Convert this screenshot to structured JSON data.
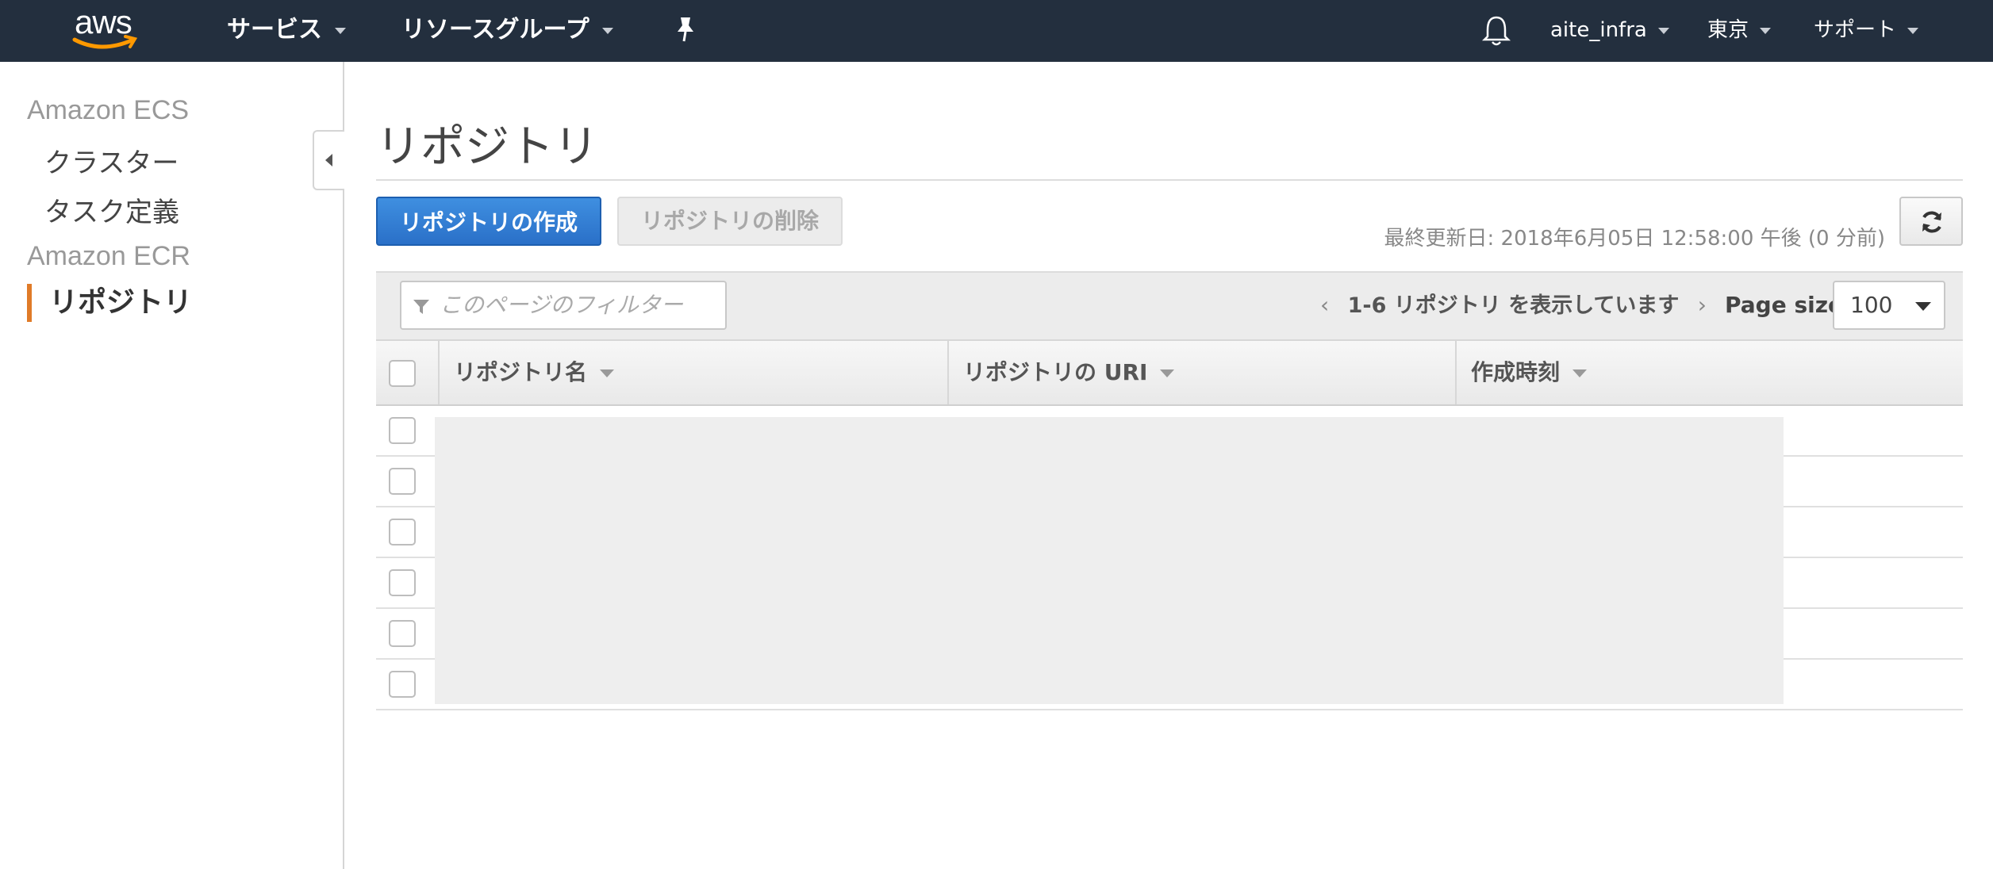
{
  "topnav": {
    "logo_text": "aws",
    "services": "サービス",
    "resource_groups": "リソースグループ",
    "pin_icon": "pin-icon",
    "bell_icon": "bell-icon",
    "account": "aite_infra",
    "region": "東京",
    "support": "サポート"
  },
  "sidebar": {
    "ecs_heading": "Amazon ECS",
    "ecs_items": [
      "クラスター",
      "タスク定義"
    ],
    "ecr_heading": "Amazon ECR",
    "ecr_active": "リポジトリ"
  },
  "main": {
    "title": "リポジトリ",
    "create_button": "リポジトリの作成",
    "delete_button": "リポジトリの削除",
    "last_updated": "最終更新日: 2018年6月05日 12:58:00 午後 (0 分前)",
    "filter_placeholder": "このページのフィルター",
    "pager_text": "1-6 リポジトリ を表示しています",
    "page_size_label": "Page size",
    "page_size_value": "100",
    "columns": [
      "リポジトリ名",
      "リポジトリの URI",
      "作成時刻"
    ],
    "row_count": 6
  },
  "colors": {
    "topbar": "#232f3e",
    "primary_button": "#2a70c8",
    "active_accent": "#e07b28"
  }
}
